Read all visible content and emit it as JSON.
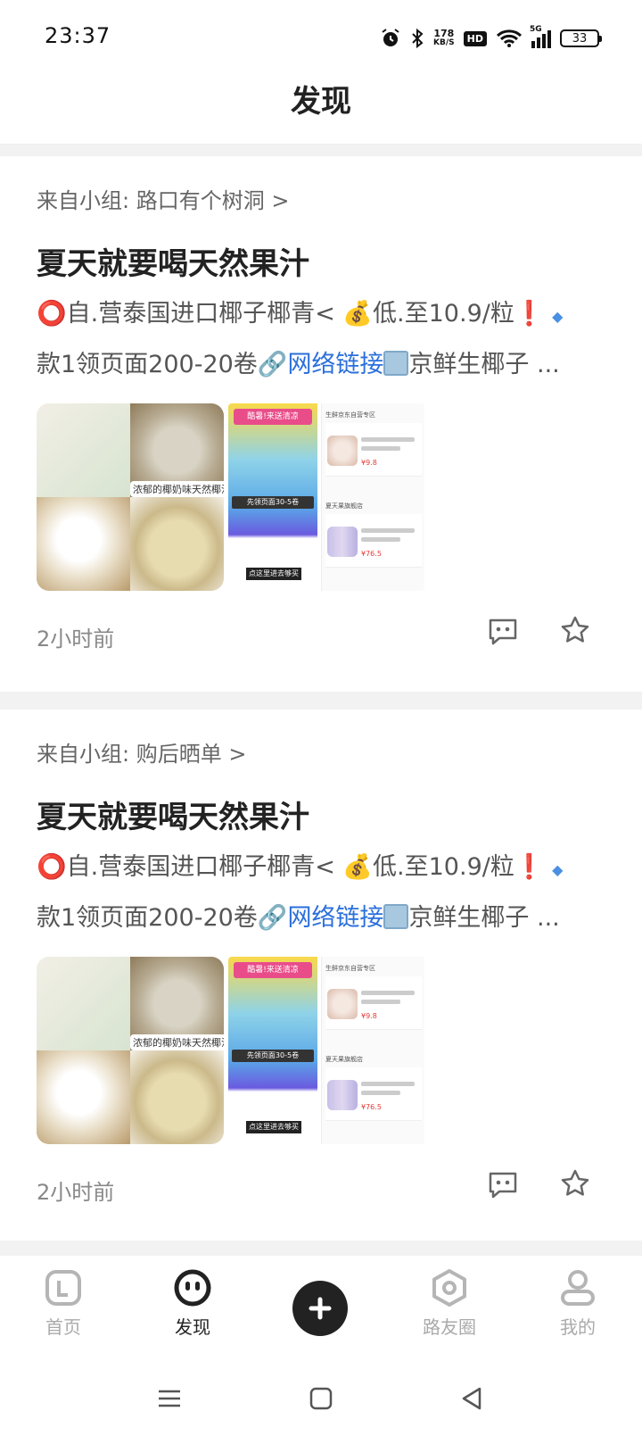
{
  "status_bar": {
    "time": "23:37",
    "net_speed_value": "178",
    "net_speed_unit": "KB/S",
    "hd_label": "HD",
    "network_label": "5G",
    "battery": "33",
    "icons": [
      "alarm-icon",
      "bluetooth-icon",
      "wifi-icon",
      "signal-icon",
      "battery-icon"
    ]
  },
  "header": {
    "title": "发现"
  },
  "feed": {
    "posts": [
      {
        "group": "来自小组: 路口有个树洞  >",
        "title": "夏天就要喝天然果汁",
        "body_line1_pre": "自.营泰国进口椰子椰青< ",
        "body_line1_mid": "低.至10.9/粒",
        "body_line2_pre": "款1领页面200-20卷",
        "body_link": "网络链接",
        "body_line2_post": "京鲜生椰子 ...",
        "image1_caption": "浓郁的椰奶味天然椰汁",
        "image2_banner": "酷暑!来送清凉",
        "image2_pill": "先领页面30-5卷",
        "image2_button": "点这里进去够买",
        "image2_store1": "生鲜京东自营专区",
        "image2_price1": "¥9.8",
        "image2_store2": "夏天果旗舰店",
        "image2_price2": "¥76.5",
        "time": "2小时前"
      },
      {
        "group": "来自小组: 购后晒单 >",
        "title": "夏天就要喝天然果汁",
        "body_line1_pre": "自.营泰国进口椰子椰青< ",
        "body_line1_mid": "低.至10.9/粒",
        "body_line2_pre": "款1领页面200-20卷",
        "body_link": "网络链接",
        "body_line2_post": "京鲜生椰子 ...",
        "image1_caption": "浓郁的椰奶味天然椰汁",
        "image2_banner": "酷暑!来送清凉",
        "image2_pill": "先领页面30-5卷",
        "image2_button": "点这里进去够买",
        "image2_store1": "生鲜京东自营专区",
        "image2_price1": "¥9.8",
        "image2_store2": "夏天果旗舰店",
        "image2_price2": "¥76.5",
        "time": "2小时前"
      }
    ]
  },
  "tabs": [
    {
      "label": "首页",
      "icon": "home-icon"
    },
    {
      "label": "发现",
      "icon": "discover-icon",
      "active": true
    },
    {
      "label": "路友圈",
      "icon": "circle-icon"
    },
    {
      "label": "我的",
      "icon": "profile-icon"
    }
  ],
  "fab": {
    "icon": "plus-icon"
  },
  "colors": {
    "link": "#2a6fdb",
    "active_tab": "#222222",
    "inactive_tab": "#aaaaaa",
    "background": "#f2f2f2"
  }
}
